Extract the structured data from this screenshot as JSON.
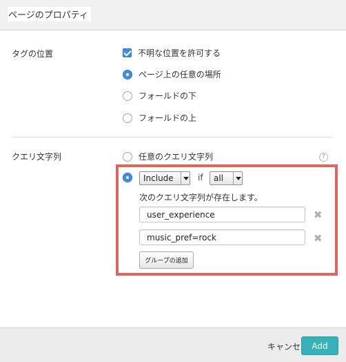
{
  "dialog": {
    "title": "ページのプロパティ"
  },
  "tag_position": {
    "label": "タグの位置",
    "allow_unknown": {
      "label": "不明な位置を許可する",
      "checked": true
    },
    "options": [
      {
        "label": "ページ上の任意の場所",
        "selected": true
      },
      {
        "label": "フォールドの下",
        "selected": false
      },
      {
        "label": "フォールドの上",
        "selected": false
      }
    ]
  },
  "query_string": {
    "label": "クエリ文字列",
    "help_glyph": "?",
    "any_option": {
      "label": "任意のクエリ文字列",
      "selected": false
    },
    "condition": {
      "selected": true,
      "mode_value": "Include",
      "if_word": "if",
      "match_value": "all",
      "description": "次のクエリ文字列が存在します。",
      "values": [
        "user_experience",
        "music_pref=rock"
      ],
      "remove_glyph": "✖",
      "add_group_label": "グループの追加"
    }
  },
  "footer": {
    "cancel_label": "キャンセル",
    "add_label": "Add"
  },
  "colors": {
    "accent": "#3d8fe3",
    "highlight": "#e0655e",
    "primary_button": "#36b3b9"
  }
}
